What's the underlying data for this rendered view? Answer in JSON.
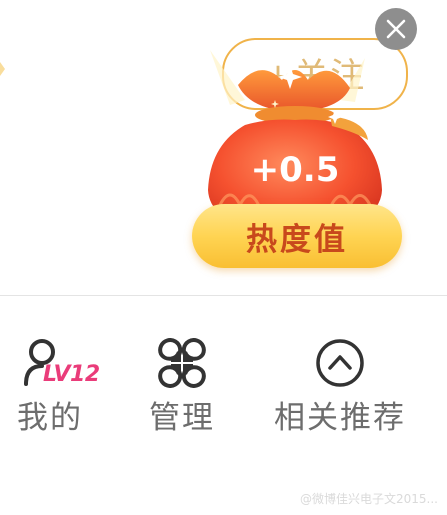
{
  "popup": {
    "follow_label": "+关注",
    "bag_value": "+0.5",
    "heat_button_label": "热度值"
  },
  "nav": {
    "items": [
      {
        "label": "我的",
        "badge": "LV12",
        "icon": "user-profile-icon"
      },
      {
        "label": "管理",
        "icon": "manage-grid-icon"
      },
      {
        "label": "相关推荐",
        "icon": "chevron-up-circle-icon"
      }
    ]
  },
  "watermark": "@微博佳兴电子文2015..."
}
